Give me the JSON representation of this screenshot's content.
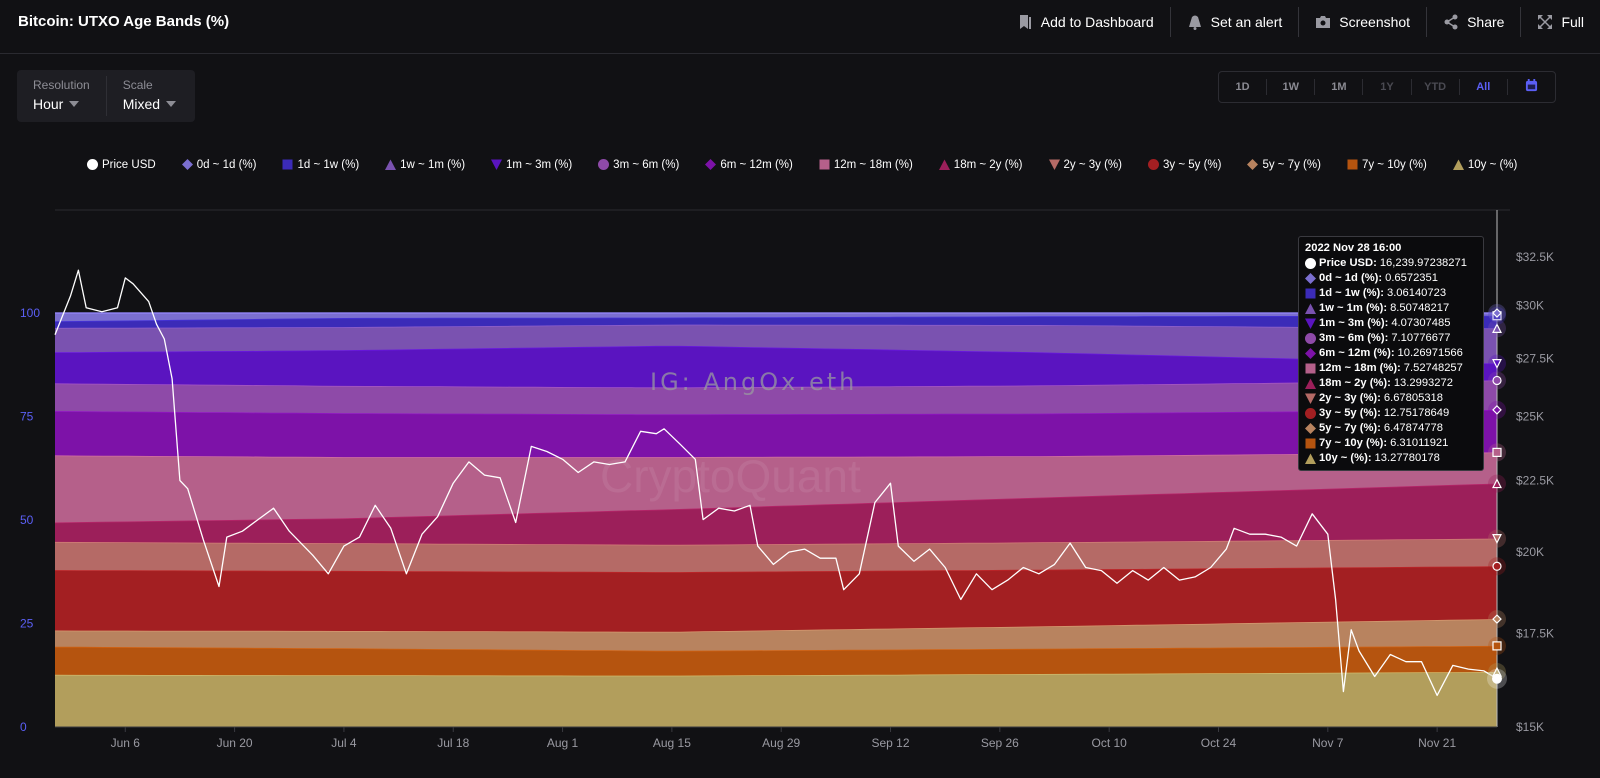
{
  "header": {
    "title": "Bitcoin: UTXO Age Bands (%)",
    "actions": [
      {
        "label": "Add to Dashboard",
        "icon": "bookmark-icon"
      },
      {
        "label": "Set an alert",
        "icon": "bell-icon"
      },
      {
        "label": "Screenshot",
        "icon": "camera-icon"
      },
      {
        "label": "Share",
        "icon": "share-icon"
      },
      {
        "label": "Full",
        "icon": "fullscreen-icon"
      }
    ]
  },
  "controls": {
    "resolution": {
      "label": "Resolution",
      "value": "Hour"
    },
    "scale": {
      "label": "Scale",
      "value": "Mixed"
    }
  },
  "range": {
    "buttons": [
      "1D",
      "1W",
      "1M",
      "1Y",
      "YTD",
      "All"
    ],
    "disabled": [
      "1Y",
      "YTD"
    ],
    "active": "All",
    "calendar_icon": "calendar-icon"
  },
  "accent_color": "#5b5ff5",
  "watermarks": {
    "ig": "IG: AngOx.eth",
    "brand": "CryptoQuant"
  },
  "tooltip": {
    "title": "2022 Nov 28 16:00",
    "rows": [
      {
        "label": "Price USD:",
        "value": "16,239.97238271"
      },
      {
        "label": "0d ~ 1d (%):",
        "value": "0.6572351"
      },
      {
        "label": "1d ~ 1w (%):",
        "value": "3.06140723"
      },
      {
        "label": "1w ~ 1m (%):",
        "value": "8.50748217"
      },
      {
        "label": "1m ~ 3m (%):",
        "value": "4.07307485"
      },
      {
        "label": "3m ~ 6m (%):",
        "value": "7.10776677"
      },
      {
        "label": "6m ~ 12m (%):",
        "value": "10.26971566"
      },
      {
        "label": "12m ~ 18m (%):",
        "value": "7.52748257"
      },
      {
        "label": "18m ~ 2y (%):",
        "value": "13.2993272"
      },
      {
        "label": "2y ~ 3y (%):",
        "value": "6.67805318"
      },
      {
        "label": "3y ~ 5y (%):",
        "value": "12.75178649"
      },
      {
        "label": "5y ~ 7y (%):",
        "value": "6.47874778"
      },
      {
        "label": "7y ~ 10y (%):",
        "value": "6.31011921"
      },
      {
        "label": "10y ~ (%):",
        "value": "13.27780178"
      }
    ]
  },
  "chart_data": {
    "type": "area",
    "stacked": true,
    "title": "Bitcoin: UTXO Age Bands (%)",
    "left_axis": {
      "ticks": [
        "0",
        "25",
        "50",
        "75",
        "100"
      ],
      "range": [
        0,
        100
      ]
    },
    "right_axis": {
      "ticks": [
        "$15K",
        "$17.5K",
        "$20K",
        "$22.5K",
        "$25K",
        "$27.5K",
        "$30K",
        "$32.5K"
      ],
      "range": [
        15000,
        32500
      ],
      "scale": "log"
    },
    "x_axis": {
      "ticks": [
        "Jun 6",
        "Jun 20",
        "Jul 4",
        "Jul 18",
        "Aug 1",
        "Aug 15",
        "Aug 29",
        "Sep 12",
        "Sep 26",
        "Oct 10",
        "Oct 24",
        "Nov 7",
        "Nov 21"
      ],
      "tick_dates": [
        "2022-06-06",
        "2022-06-20",
        "2022-07-04",
        "2022-07-18",
        "2022-08-01",
        "2022-08-15",
        "2022-08-29",
        "2022-09-12",
        "2022-09-26",
        "2022-10-10",
        "2022-10-24",
        "2022-11-07",
        "2022-11-21"
      ],
      "range": [
        "2022-05-28",
        "2022-11-28 16:00"
      ]
    },
    "legend_position": "top",
    "grid": false,
    "band_dates": [
      "2022-05-28",
      "2022-07-04",
      "2022-08-15",
      "2022-10-01",
      "2022-11-28 16:00"
    ],
    "bands": [
      {
        "name": "10y ~ (%)",
        "color": "#b29e5c",
        "marker": "triangle-up",
        "values": [
          12.6,
          12.5,
          12.4,
          12.8,
          13.28
        ]
      },
      {
        "name": "7y ~ 10y (%)",
        "color": "#b5540f",
        "marker": "square",
        "values": [
          6.8,
          6.5,
          6.0,
          6.1,
          6.31
        ]
      },
      {
        "name": "5y ~ 7y (%)",
        "color": "#b8835f",
        "marker": "diamond",
        "values": [
          3.9,
          4.2,
          4.6,
          5.4,
          6.48
        ]
      },
      {
        "name": "3y ~ 5y (%)",
        "color": "#a31f22",
        "marker": "circle",
        "values": [
          14.6,
          14.5,
          14.4,
          13.7,
          12.75
        ]
      },
      {
        "name": "2y ~ 3y (%)",
        "color": "#b56a66",
        "marker": "triangle-down",
        "values": [
          6.8,
          6.7,
          6.6,
          6.6,
          6.68
        ]
      },
      {
        "name": "18m ~ 2y (%)",
        "color": "#9c1f5a",
        "marker": "triangle-up",
        "values": [
          4.7,
          6.0,
          8.6,
          10.8,
          13.3
        ]
      },
      {
        "name": "12m ~ 18m (%)",
        "color": "#b5608a",
        "marker": "square",
        "values": [
          16.2,
          14.8,
          12.6,
          10.0,
          7.53
        ]
      },
      {
        "name": "6m ~ 12m (%)",
        "color": "#7d12a8",
        "marker": "diamond",
        "values": [
          10.7,
          10.6,
          10.3,
          10.3,
          10.27
        ]
      },
      {
        "name": "3m ~ 6m (%)",
        "color": "#8e4aa8",
        "marker": "circle",
        "values": [
          6.7,
          6.6,
          6.5,
          6.8,
          7.11
        ]
      },
      {
        "name": "1m ~ 3m (%)",
        "color": "#5a14c0",
        "marker": "triangle-down",
        "values": [
          7.5,
          8.6,
          10.1,
          8.0,
          4.07
        ]
      },
      {
        "name": "1w ~ 1m (%)",
        "color": "#7a52b0",
        "marker": "triangle-up",
        "values": [
          5.9,
          5.6,
          5.1,
          6.6,
          8.51
        ]
      },
      {
        "name": "1d ~ 1w (%)",
        "color": "#3b2bb8",
        "marker": "square",
        "values": [
          1.6,
          2.2,
          1.7,
          2.1,
          3.06
        ]
      },
      {
        "name": "0d ~ 1d (%)",
        "color": "#7b6fd0",
        "marker": "diamond",
        "values": [
          2.0,
          1.2,
          1.1,
          0.8,
          0.66
        ]
      }
    ],
    "price": {
      "name": "Price USD",
      "color": "#ffffff",
      "marker": "circle",
      "dates": [
        "2022-05-28",
        "2022-05-30",
        "2022-05-31",
        "2022-06-01",
        "2022-06-03",
        "2022-06-05",
        "2022-06-06",
        "2022-06-07",
        "2022-06-09",
        "2022-06-10",
        "2022-06-11",
        "2022-06-12",
        "2022-06-13",
        "2022-06-14",
        "2022-06-16",
        "2022-06-18",
        "2022-06-19",
        "2022-06-21",
        "2022-06-23",
        "2022-06-25",
        "2022-06-27",
        "2022-06-30",
        "2022-07-02",
        "2022-07-04",
        "2022-07-06",
        "2022-07-08",
        "2022-07-10",
        "2022-07-12",
        "2022-07-14",
        "2022-07-16",
        "2022-07-18",
        "2022-07-20",
        "2022-07-22",
        "2022-07-24",
        "2022-07-26",
        "2022-07-28",
        "2022-07-30",
        "2022-08-01",
        "2022-08-03",
        "2022-08-05",
        "2022-08-07",
        "2022-08-09",
        "2022-08-11",
        "2022-08-13",
        "2022-08-14",
        "2022-08-16",
        "2022-08-18",
        "2022-08-19",
        "2022-08-21",
        "2022-08-23",
        "2022-08-25",
        "2022-08-26",
        "2022-08-28",
        "2022-08-30",
        "2022-09-01",
        "2022-09-03",
        "2022-09-05",
        "2022-09-06",
        "2022-09-08",
        "2022-09-10",
        "2022-09-12",
        "2022-09-13",
        "2022-09-15",
        "2022-09-17",
        "2022-09-19",
        "2022-09-21",
        "2022-09-23",
        "2022-09-25",
        "2022-09-27",
        "2022-09-29",
        "2022-10-01",
        "2022-10-03",
        "2022-10-05",
        "2022-10-07",
        "2022-10-09",
        "2022-10-11",
        "2022-10-13",
        "2022-10-15",
        "2022-10-17",
        "2022-10-19",
        "2022-10-21",
        "2022-10-23",
        "2022-10-25",
        "2022-10-26",
        "2022-10-28",
        "2022-10-30",
        "2022-11-01",
        "2022-11-03",
        "2022-11-05",
        "2022-11-07",
        "2022-11-08",
        "2022-11-09",
        "2022-11-10",
        "2022-11-11",
        "2022-11-13",
        "2022-11-15",
        "2022-11-17",
        "2022-11-19",
        "2022-11-21",
        "2022-11-23",
        "2022-11-25",
        "2022-11-27",
        "2022-11-28 16:00"
      ],
      "values": [
        28600,
        30500,
        31800,
        29900,
        29700,
        29900,
        31400,
        31100,
        30200,
        29100,
        28400,
        26600,
        22500,
        22200,
        20400,
        18900,
        20500,
        20700,
        21100,
        21500,
        20700,
        19900,
        19300,
        20200,
        20500,
        21600,
        20800,
        19300,
        20600,
        21200,
        22400,
        23200,
        22700,
        22600,
        21000,
        23800,
        23600,
        23300,
        22800,
        23200,
        23100,
        23200,
        24400,
        24300,
        24500,
        23900,
        23300,
        21100,
        21500,
        21400,
        21600,
        20200,
        19600,
        20000,
        20100,
        19800,
        19800,
        18800,
        19300,
        21700,
        22400,
        20200,
        19700,
        20100,
        19500,
        18500,
        19300,
        18800,
        19100,
        19500,
        19300,
        19600,
        20300,
        19500,
        19400,
        19000,
        19400,
        19100,
        19500,
        19100,
        19200,
        19500,
        20100,
        20800,
        20600,
        20600,
        20500,
        20200,
        21300,
        20600,
        18500,
        15900,
        17600,
        17000,
        16300,
        16900,
        16700,
        16700,
        15800,
        16600,
        16500,
        16450,
        16240
      ]
    }
  }
}
